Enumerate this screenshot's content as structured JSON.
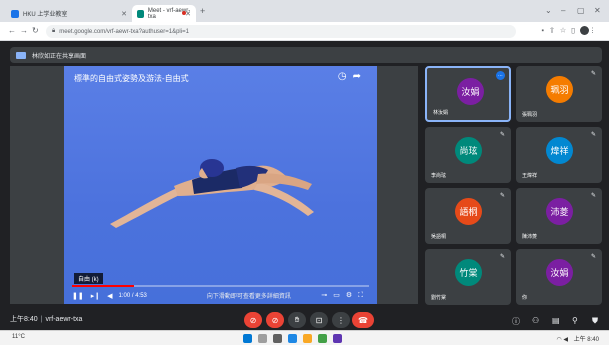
{
  "tabs": [
    {
      "label": "HKU 上学业教室"
    },
    {
      "label": "Meet - vrf-aewr-txa"
    }
  ],
  "address": {
    "url": "meet.google.com/vrf-aewr-txa?authuser=1&pli=1"
  },
  "window_controls": {
    "min": "–",
    "max": "▢",
    "close": "✕"
  },
  "presentation": {
    "banner": "林欣如正在共享画面"
  },
  "video": {
    "title": "標準的自由式姿勢及游法-自由式",
    "caption": "自由 (k)",
    "current_time": "1:00",
    "total_time": "4:53",
    "time_display": "1:00 / 4:53",
    "next_label": "向下滑動即可查看更多詳細資訊",
    "progress": 0.21
  },
  "participants": [
    {
      "initials": "汝娟",
      "name": "林汝娟",
      "color": "#7b1fa2",
      "active": true
    },
    {
      "initials": "珮羽",
      "name": "張珮羽",
      "color": "#f57c00",
      "active": false
    },
    {
      "initials": "尚玹",
      "name": "李尚玹",
      "color": "#00897b",
      "active": false
    },
    {
      "initials": "煒祥",
      "name": "王煒祥",
      "color": "#0288d1",
      "active": false
    },
    {
      "initials": "語桐",
      "name": "吳語桐",
      "color": "#e64a19",
      "active": false
    },
    {
      "initials": "沛菱",
      "name": "陳沛菱",
      "color": "#7b1fa2",
      "active": false
    },
    {
      "initials": "竹棠",
      "name": "劉竹棠",
      "color": "#00897b",
      "active": false
    },
    {
      "initials": "汝娟",
      "name": "你",
      "color": "#7b1fa2",
      "active": false
    }
  ],
  "bottom": {
    "time": "上午8:40",
    "meeting_code": "vrf-aewr-txa"
  },
  "taskbar": {
    "weather": "11°C",
    "tray_time": "上午 8:40"
  }
}
